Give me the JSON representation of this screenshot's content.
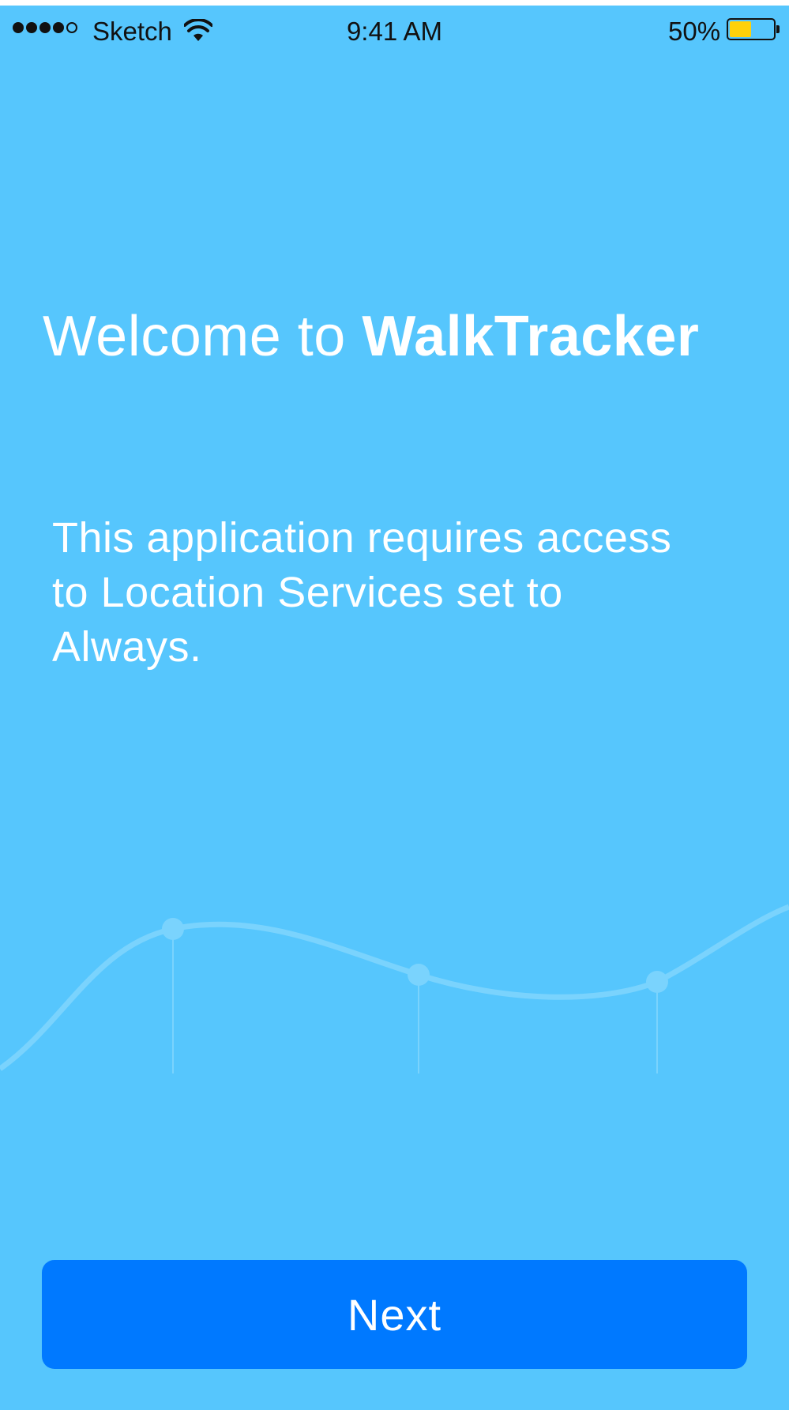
{
  "status_bar": {
    "signal_bars_filled": 4,
    "signal_bars_total": 5,
    "carrier": "Sketch",
    "time": "9:41 AM",
    "battery_percent_label": "50%",
    "battery_level": 0.5,
    "battery_color": "#FFD10A"
  },
  "welcome": {
    "prefix": "Welcome to ",
    "app_name": "WalkTracker"
  },
  "message": "This application requires access to Location Services set to Always.",
  "next_button": {
    "label": "Next"
  },
  "colors": {
    "background": "#56C6FD",
    "button": "#0079FF",
    "text": "#FFFFFF"
  }
}
